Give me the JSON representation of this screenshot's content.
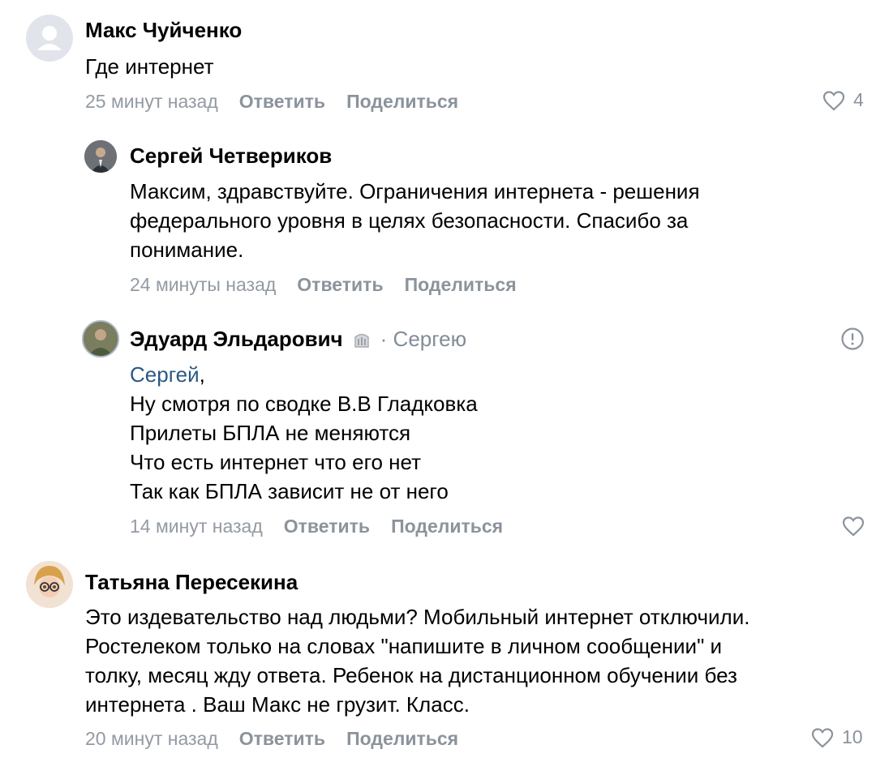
{
  "comments": [
    {
      "author": "Макс Чуйченко",
      "text": "Где интернет",
      "time": "25 минут назад",
      "reply_label": "Ответить",
      "share_label": "Поделиться",
      "likes": "4"
    },
    {
      "author": "Сергей Четвериков",
      "text": "Максим, здравствуйте. Ограничения интернета - решения\nфедерального уровня в целях безопасности. Спасибо за\nпонимание.",
      "time": "24 минуты назад",
      "reply_label": "Ответить",
      "share_label": "Поделиться"
    },
    {
      "author": "Эдуард Эльдарович",
      "reply_to": "· Сергею",
      "mention": "Сергей",
      "text_after_mention": ",\nНу смотря по сводке В.В Гладковка\nПрилеты БПЛА не меняются\nЧто есть интернет что его нет\nТак как БПЛА зависит не от него",
      "time": "14 минут назад",
      "reply_label": "Ответить",
      "share_label": "Поделиться"
    },
    {
      "author": "Татьяна Пересекина",
      "text": "Это издевательство над людьми? Мобильный интернет отключили.\nРостелеком только на словах \"напишите в личном сообщении\" и\nтолку, месяц жду ответа. Ребенок на дистанционном обучении без\nинтернета . Ваш Макс не грузит. Класс.",
      "time": "20 минут назад",
      "reply_label": "Ответить",
      "share_label": "Поделиться",
      "likes": "10"
    }
  ],
  "colors": {
    "meta": "#939aa3",
    "link": "#2a5885"
  }
}
